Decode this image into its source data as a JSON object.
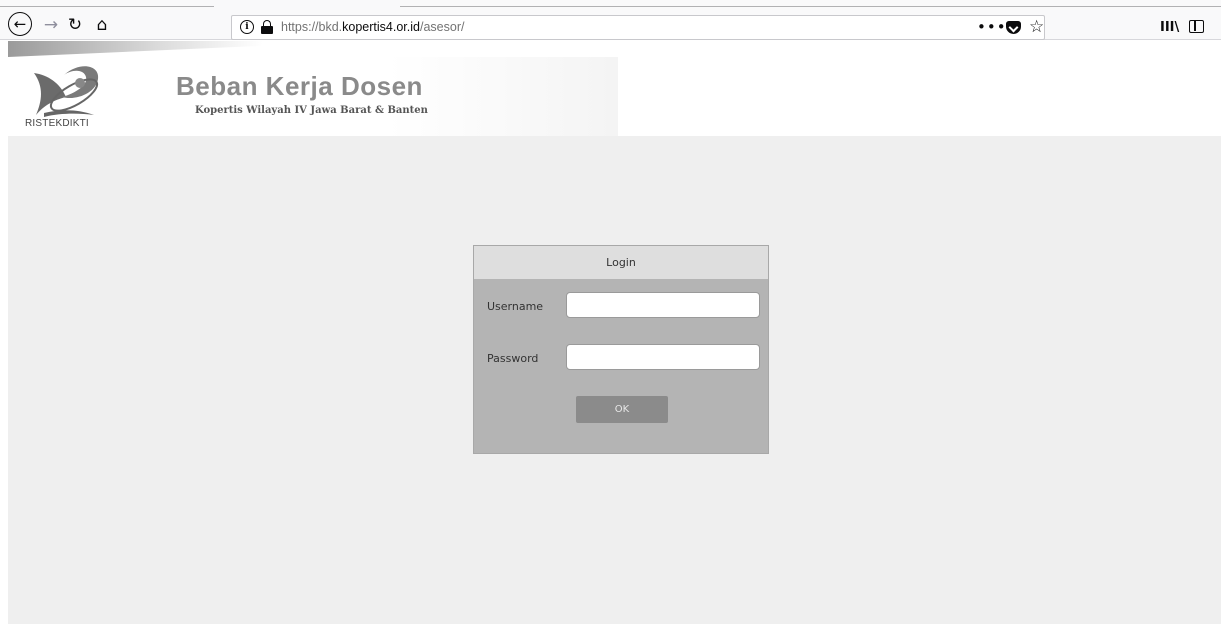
{
  "browser": {
    "url_prefix": "https://bkd.",
    "url_domain": "kopertis4.or.id",
    "url_path": "/asesor/",
    "icons": {
      "back": "back-arrow-icon",
      "forward": "forward-arrow-icon",
      "reload": "reload-icon",
      "home": "home-icon",
      "info": "info-icon",
      "lock": "lock-icon",
      "more": "more-icon",
      "pocket": "pocket-icon",
      "bookmark": "star-icon",
      "library": "library-icon",
      "sidebar": "sidebar-icon"
    },
    "more_glyph": "•••",
    "star_glyph": "☆",
    "library_glyph": "III\\",
    "back_glyph": "←",
    "forward_glyph": "→",
    "reload_glyph": "↻",
    "home_glyph": "⌂",
    "info_glyph": "i"
  },
  "header": {
    "logo_text": "RISTEKDIKTI",
    "title": "Beban Kerja Dosen",
    "subtitle": "Kopertis Wilayah IV Jawa Barat & Banten"
  },
  "login": {
    "title": "Login",
    "username_label": "Username",
    "password_label": "Password",
    "username_value": "",
    "password_value": "",
    "ok_label": "OK"
  },
  "colors": {
    "page_background": "#efefef",
    "login_panel": "#b4b4b4",
    "login_header": "#dedede",
    "ok_button": "#8b8b8b",
    "title_text": "#8a8a8a"
  }
}
